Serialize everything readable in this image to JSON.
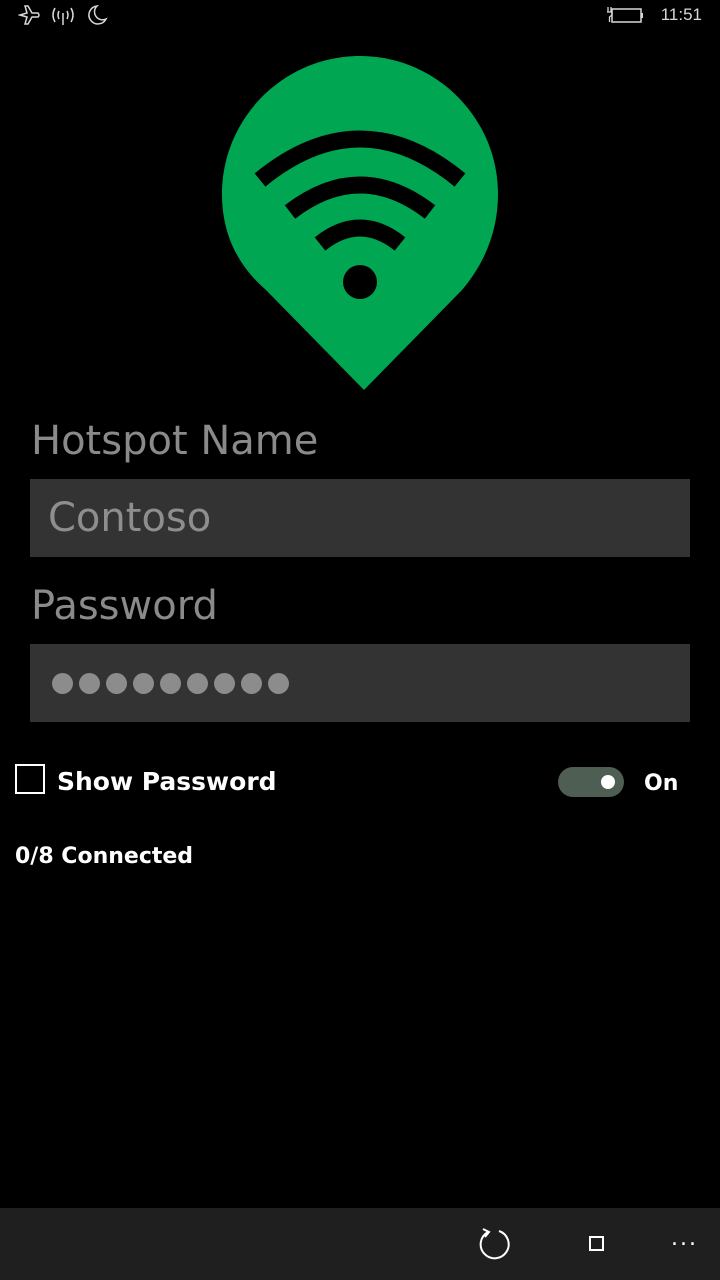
{
  "status_bar": {
    "time": "11:51",
    "icons": [
      "airplane-icon",
      "signal-icon",
      "quiet-hours-moon-icon",
      "battery-charging-icon"
    ]
  },
  "logo": {
    "icon": "wifi-location-pin-icon",
    "color": "#00a651"
  },
  "form": {
    "hotspot_name_label": "Hotspot Name",
    "hotspot_name_value": "Contoso",
    "password_label": "Password",
    "password_masked_length": 9
  },
  "show_password": {
    "label": "Show Password",
    "checked": false
  },
  "toggle": {
    "label": "On",
    "state": true
  },
  "connection_status": "0/8 Connected",
  "app_bar": {
    "buttons": [
      "refresh-icon",
      "stop-icon"
    ],
    "more": "..."
  }
}
